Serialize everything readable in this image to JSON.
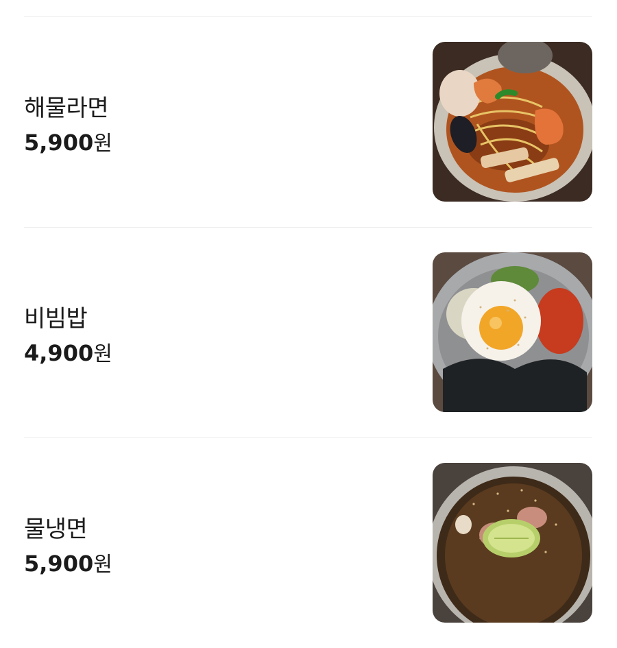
{
  "menu": {
    "items": [
      {
        "name": "해물라면",
        "price": "5,900",
        "currency": "원",
        "photo_icon": "seafood-ramen-photo"
      },
      {
        "name": "비빔밥",
        "price": "4,900",
        "currency": "원",
        "photo_icon": "bibimbap-photo"
      },
      {
        "name": "물냉면",
        "price": "5,900",
        "currency": "원",
        "photo_icon": "cold-noodles-photo"
      }
    ]
  }
}
